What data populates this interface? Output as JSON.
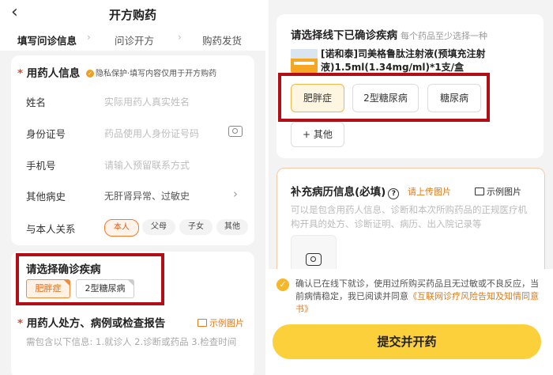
{
  "left": {
    "header": {
      "back_icon": "chevron-left-icon",
      "title": "开方购药"
    },
    "steps": [
      {
        "label": "填写问诊信息",
        "active": true
      },
      {
        "label": "问诊开方",
        "active": false
      },
      {
        "label": "购药发货",
        "active": false
      }
    ],
    "user_info": {
      "required_mark": "*",
      "title": "用药人信息",
      "privacy_note": "隐私保护·填写内容仅用于开方购药",
      "rows": [
        {
          "label": "姓名",
          "placeholder": "实际用药人真实姓名"
        },
        {
          "label": "身份证号",
          "placeholder": "药品使用人身份证号码"
        },
        {
          "label": "手机号",
          "placeholder": "请输入预留联系方式"
        },
        {
          "label": "其他病史",
          "value": "无肝肾异常、过敏史"
        },
        {
          "label": "与本人关系"
        }
      ],
      "relations": [
        "本人",
        "父母",
        "子女",
        "其他"
      ],
      "selected_relation": "本人"
    },
    "diagnosis": {
      "title": "请选择确诊疾病",
      "chips": [
        {
          "label": "肥胖症",
          "selected": true
        },
        {
          "label": "2型糖尿病",
          "selected": false
        }
      ]
    },
    "prescription": {
      "required_mark": "*",
      "title": "用药人处方、病例或检查报告",
      "example_label": "示例图片",
      "hint": "需包含以下信息: 1.就诊人 2.诊断或药品 3.检查时间"
    }
  },
  "right": {
    "offline": {
      "title": "请选择线下已确诊疾病",
      "subtitle": "每个药品至少选择一种",
      "drug_name": "[诺和泰]司美格鲁肽注射液(预填充注射液)1.5ml(1.34mg/ml)*1支/盒",
      "chips": [
        {
          "label": "肥胖症",
          "selected": true
        },
        {
          "label": "2型糖尿病",
          "selected": false
        },
        {
          "label": "糖尿病",
          "selected": false
        }
      ],
      "other_label": "其他"
    },
    "history": {
      "title": "补充病历信息(必填)",
      "upload_label": "请上传图片",
      "example_label": "示例图片",
      "hint": "可以是包含用药人信息、诊断和本次所购药品的正规医疗机构开具的处方、诊断证明、病历、出入院记录等"
    },
    "consent": {
      "text": "确认已在线下就诊，使用过所购买药品且无过敏或不良反应，当前病情稳定，我已阅读并同意",
      "link": "《互联网诊疗风险告知及知情同意书》"
    },
    "submit_label": "提交并开药"
  },
  "colors": {
    "accent_orange": "#f07a2a",
    "highlight_red": "#b10e16",
    "button_yellow": "#fcd03a"
  }
}
